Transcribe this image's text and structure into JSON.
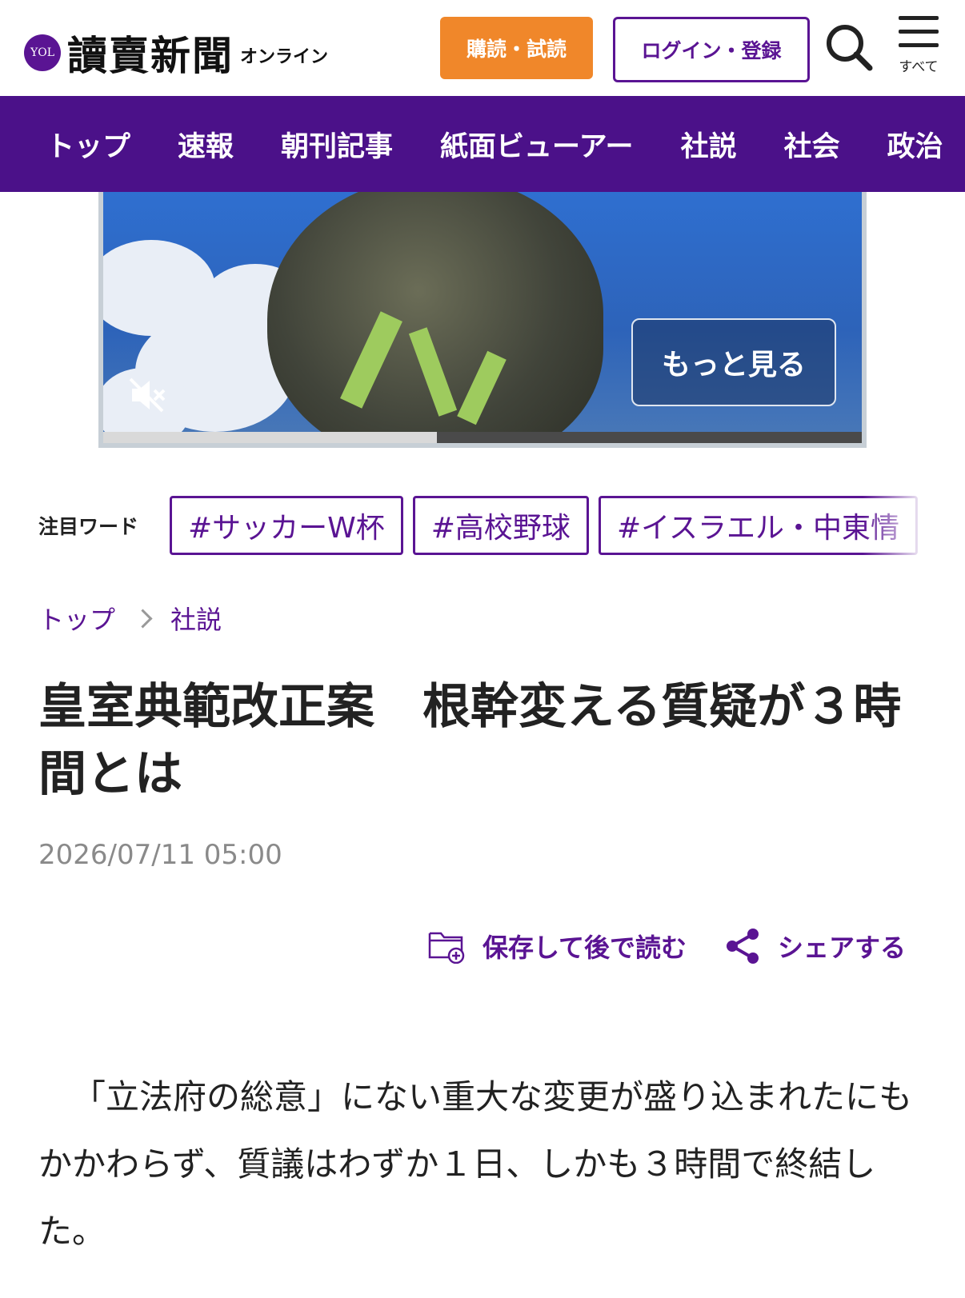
{
  "header": {
    "logo_badge": "YOL",
    "logo_name": "讀賣新聞",
    "logo_sub": "オンライン",
    "subscribe_label": "購読・試読",
    "login_label": "ログイン・登録",
    "menu_label": "すべて",
    "icons": {
      "search": "search-icon",
      "menu": "hamburger-menu-icon"
    }
  },
  "nav": {
    "items": [
      "トップ",
      "速報",
      "朝刊記事",
      "紙面ビューアー",
      "社説",
      "社会",
      "政治"
    ]
  },
  "video": {
    "more_label": "もっと見る",
    "muted": true,
    "progress": 0.44
  },
  "trending": {
    "label": "注目ワード",
    "tags": [
      "#サッカーW杯",
      "#高校野球",
      "#イスラエル・中東情"
    ]
  },
  "breadcrumb": {
    "items": [
      "トップ",
      "社説"
    ]
  },
  "article": {
    "title": "皇室典範改正案　根幹変える質疑が３時間とは",
    "date": "2026/07/11 05:00",
    "save_label": "保存して後で読む",
    "share_label": "シェアする",
    "body": "「立法府の総意」にない重大な変更が盛り込まれたにもかかわらず、質議はわずか１日、しかも３時間で終結した。"
  },
  "colors": {
    "brand": "#4b1189",
    "accent": "#5a1493",
    "subscribe": "#f0872a"
  }
}
